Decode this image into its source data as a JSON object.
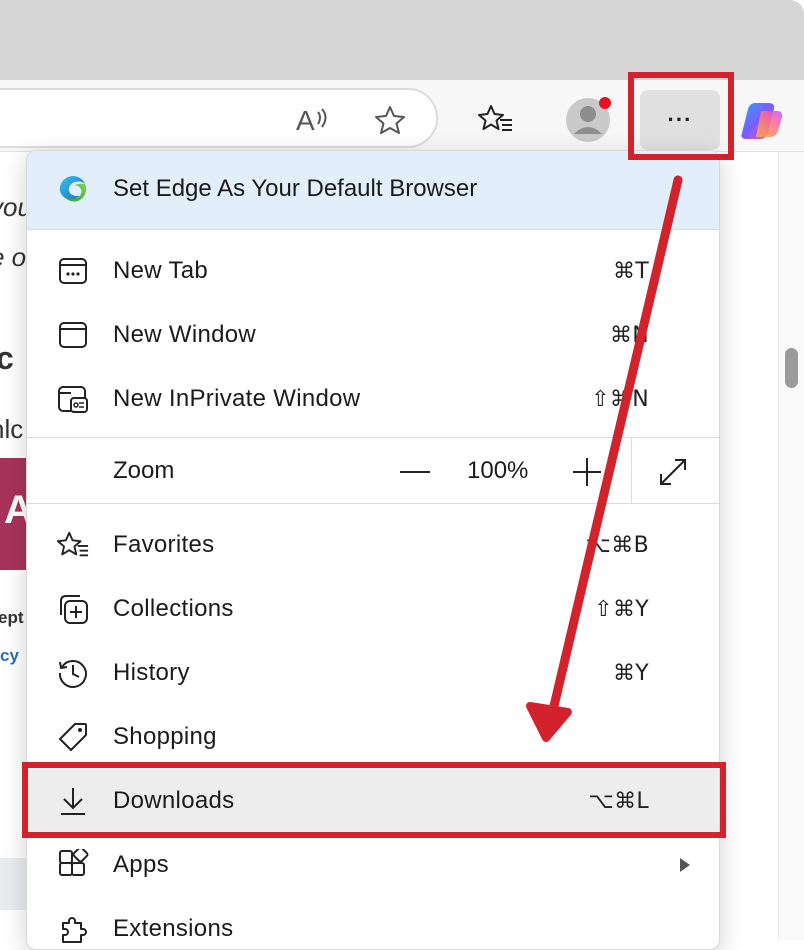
{
  "menu": {
    "banner": {
      "label": "Set Edge As Your Default Browser",
      "icon": "edge-logo-icon"
    },
    "items": [
      {
        "label": "New Tab",
        "shortcut": "⌘T",
        "icon": "new-tab-icon"
      },
      {
        "label": "New Window",
        "shortcut": "⌘N",
        "icon": "new-window-icon"
      },
      {
        "label": "New InPrivate Window",
        "shortcut": "⇧⌘N",
        "icon": "inprivate-icon"
      }
    ],
    "zoom": {
      "label": "Zoom",
      "value": "100%",
      "minus": "—",
      "plus": "+"
    },
    "items2": [
      {
        "label": "Favorites",
        "shortcut": "⌥⌘B",
        "icon": "favorites-icon"
      },
      {
        "label": "Collections",
        "shortcut": "⇧⌘Y",
        "icon": "collections-icon"
      },
      {
        "label": "History",
        "shortcut": "⌘Y",
        "icon": "history-icon"
      },
      {
        "label": "Shopping",
        "shortcut": "",
        "icon": "shopping-tag-icon"
      },
      {
        "label": "Downloads",
        "shortcut": "⌥⌘L",
        "icon": "download-icon"
      },
      {
        "label": "Apps",
        "shortcut": "",
        "icon": "apps-icon"
      },
      {
        "label": "Extensions",
        "shortcut": "",
        "icon": "extensions-icon"
      }
    ]
  },
  "toolbar": {
    "read_aloud_label": "A",
    "more_label": "···"
  },
  "background_fragments": [
    "you",
    "e o",
    "c",
    "nlc",
    "A",
    "ept",
    "cy"
  ],
  "annotation_color": "#d2232c"
}
